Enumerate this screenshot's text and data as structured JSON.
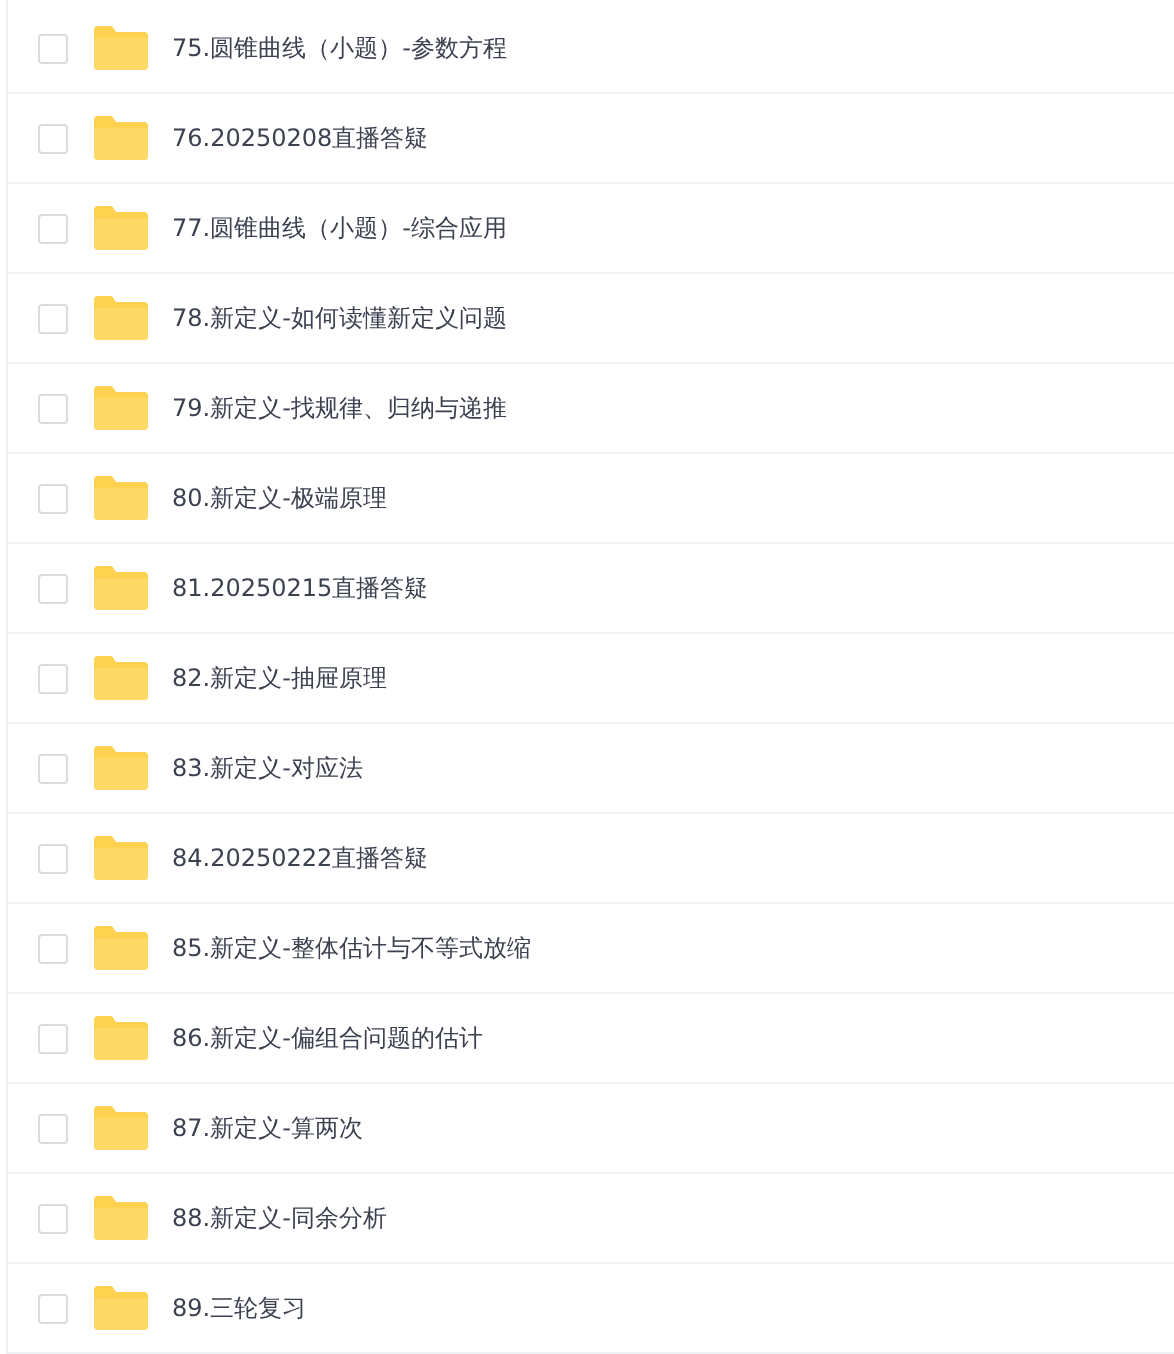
{
  "files": [
    {
      "name": "75.圆锥曲线（小题）-参数方程",
      "checked": false
    },
    {
      "name": "76.20250208直播答疑",
      "checked": false
    },
    {
      "name": "77.圆锥曲线（小题）-综合应用",
      "checked": false
    },
    {
      "name": "78.新定义-如何读懂新定义问题",
      "checked": false
    },
    {
      "name": "79.新定义-找规律、归纳与递推",
      "checked": false
    },
    {
      "name": "80.新定义-极端原理",
      "checked": false
    },
    {
      "name": "81.20250215直播答疑",
      "checked": false
    },
    {
      "name": "82.新定义-抽屉原理",
      "checked": false
    },
    {
      "name": "83.新定义-对应法",
      "checked": false
    },
    {
      "name": "84.20250222直播答疑",
      "checked": false
    },
    {
      "name": "85.新定义-整体估计与不等式放缩",
      "checked": false
    },
    {
      "name": "86.新定义-偏组合问题的估计",
      "checked": false
    },
    {
      "name": "87.新定义-算两次",
      "checked": false
    },
    {
      "name": "88.新定义-同余分析",
      "checked": false
    },
    {
      "name": "89.三轮复习",
      "checked": false
    }
  ]
}
